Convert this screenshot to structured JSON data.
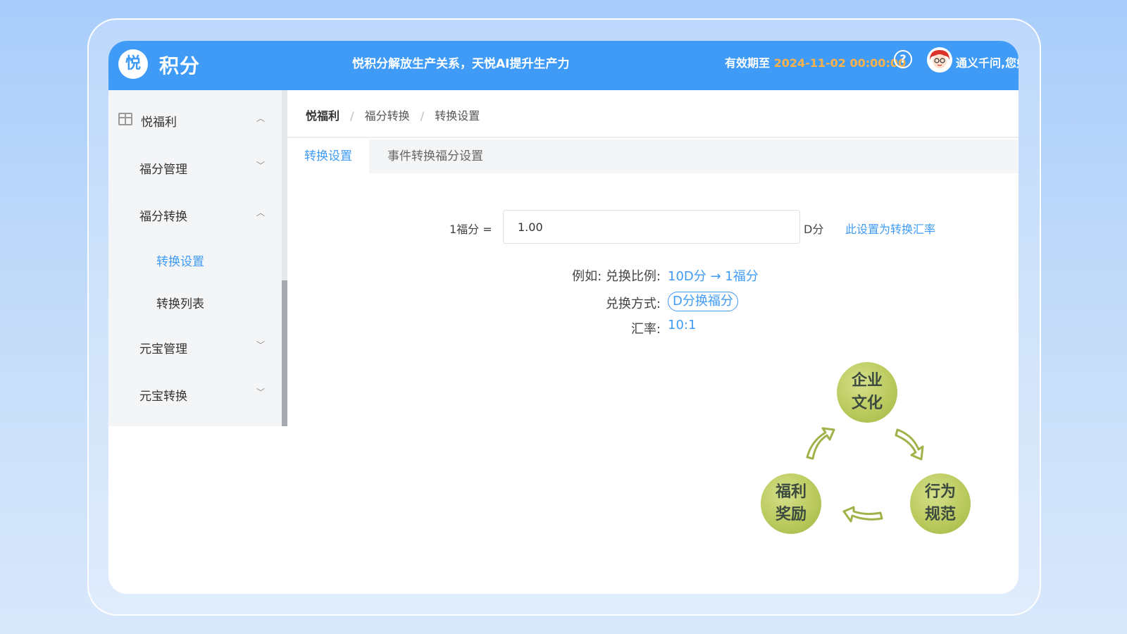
{
  "header": {
    "logo_glyph": "悦",
    "app_title": "积分",
    "slogan": "悦积分解放生产关系，天悦AI提升生产力",
    "expiry_label": "有效期至",
    "expiry_date": "2024-11-02 00:00:00",
    "help_glyph": "?",
    "username": "通义千问,您好"
  },
  "sidebar": {
    "items": [
      {
        "label": "悦福利",
        "chevron": "︿"
      },
      {
        "label": "福分管理",
        "chevron": "﹀"
      },
      {
        "label": "福分转换",
        "chevron": "︿"
      },
      {
        "label": "转换设置"
      },
      {
        "label": "转换列表"
      },
      {
        "label": "元宝管理",
        "chevron": "﹀"
      },
      {
        "label": "元宝转换",
        "chevron": "﹀"
      }
    ]
  },
  "breadcrumb": [
    "悦福利",
    "福分转换",
    "转换设置"
  ],
  "breadcrumb_sep": "/",
  "tabs": [
    {
      "label": "转换设置",
      "active": true
    },
    {
      "label": "事件转换福分设置",
      "active": false
    }
  ],
  "form": {
    "label": "1福分 =",
    "value": "1.00",
    "unit": "D分",
    "link": "此设置为转换汇率"
  },
  "info": {
    "example_key": "例如: 兑换比例:",
    "example_val": "10D分 → 1福分",
    "method_key": "兑换方式:",
    "method_val": "D分换福分",
    "rate_key": "汇率:",
    "rate_val": "10:1"
  },
  "illustration": {
    "top": "企业\n文化",
    "left": "福利\n奖励",
    "right": "行为\n规范",
    "top_lines": [
      "企业",
      "文化"
    ],
    "left_lines": [
      "福利",
      "奖励"
    ],
    "right_lines": [
      "行为",
      "规范"
    ]
  },
  "colors": {
    "primary": "#3f9bf5",
    "expiry_date": "#ffb24a",
    "bubble": "#b8c85a"
  }
}
